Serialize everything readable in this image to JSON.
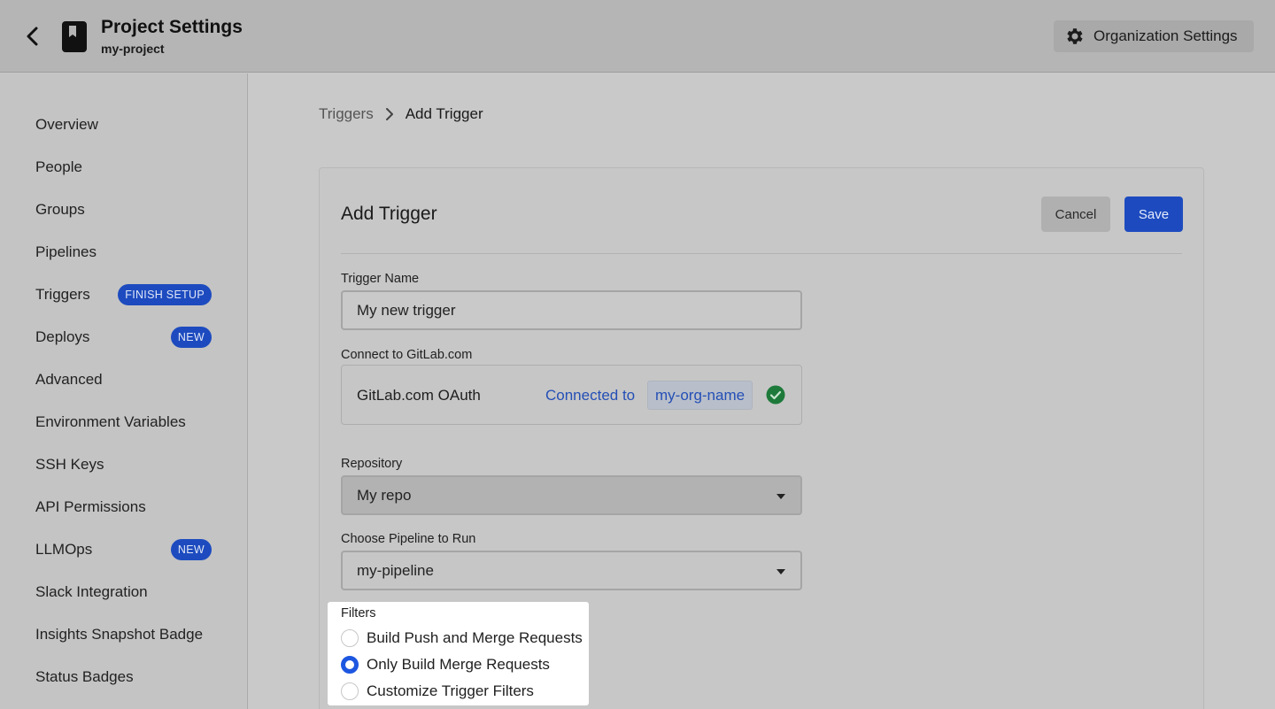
{
  "header": {
    "title": "Project Settings",
    "subtitle": "my-project",
    "org_settings_label": "Organization Settings"
  },
  "sidebar": {
    "items": [
      {
        "label": "Overview"
      },
      {
        "label": "People"
      },
      {
        "label": "Groups"
      },
      {
        "label": "Pipelines"
      },
      {
        "label": "Triggers",
        "badge": "FINISH SETUP"
      },
      {
        "label": "Deploys",
        "badge": "NEW"
      },
      {
        "label": "Advanced"
      },
      {
        "label": "Environment Variables"
      },
      {
        "label": "SSH Keys"
      },
      {
        "label": "API Permissions"
      },
      {
        "label": "LLMOps",
        "badge": "NEW"
      },
      {
        "label": "Slack Integration"
      },
      {
        "label": "Insights Snapshot Badge"
      },
      {
        "label": "Status Badges"
      }
    ]
  },
  "breadcrumb": {
    "parent": "Triggers",
    "current": "Add Trigger"
  },
  "form": {
    "title": "Add Trigger",
    "cancel_label": "Cancel",
    "save_label": "Save",
    "trigger_name_label": "Trigger Name",
    "trigger_name_value": "My new trigger",
    "connect_label": "Connect to GitLab.com",
    "oauth_name": "GitLab.com OAuth",
    "connected_to": "Connected to",
    "org_name": "my-org-name",
    "repository_label": "Repository",
    "repository_value": "My repo",
    "pipeline_label": "Choose Pipeline to Run",
    "pipeline_value": "my-pipeline",
    "filters_label": "Filters",
    "filter_options": [
      {
        "label": "Build Push and Merge Requests",
        "checked": false
      },
      {
        "label": "Only Build Merge Requests",
        "checked": true
      },
      {
        "label": "Customize Trigger Filters",
        "checked": false
      }
    ]
  },
  "colors": {
    "accent": "#1d4bbf",
    "radio_selected": "#1d56e0",
    "success": "#1e7a3a"
  }
}
